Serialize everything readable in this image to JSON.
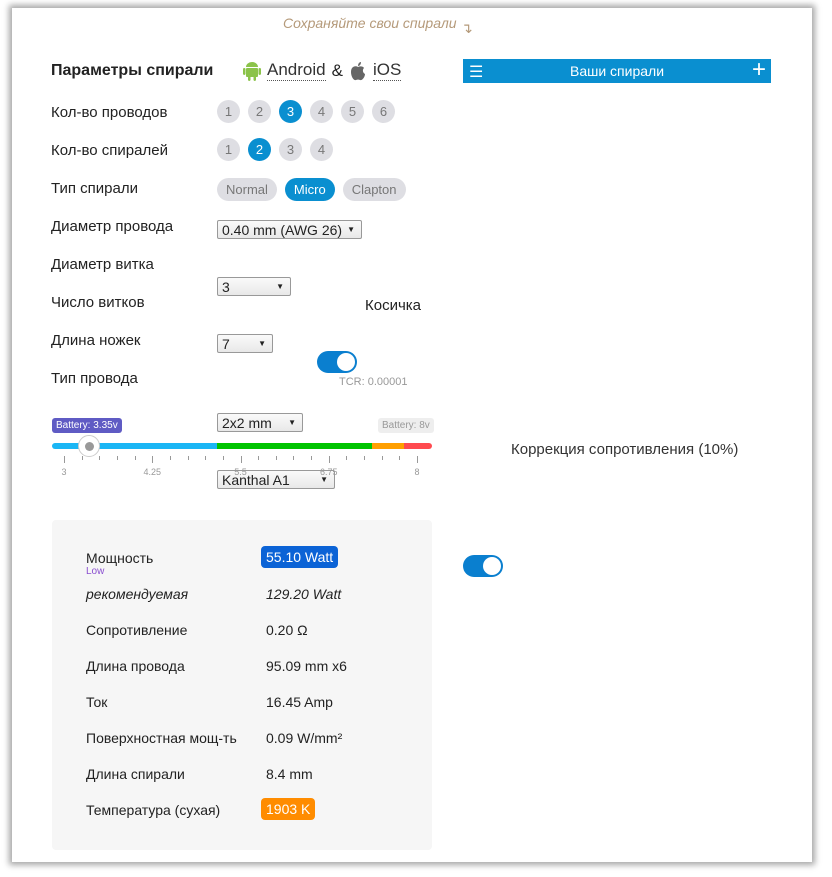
{
  "hint": "Сохраняйте свои спирали",
  "header": {
    "title": "Параметры спирали",
    "android": "Android",
    "amp": "&",
    "ios": "iOS"
  },
  "coils_bar": {
    "title": "Ваши спирали"
  },
  "wires": {
    "label": "Кол-во проводов",
    "options": [
      "1",
      "2",
      "3",
      "4",
      "5",
      "6"
    ],
    "selected": "3"
  },
  "coils": {
    "label": "Кол-во спиралей",
    "options": [
      "1",
      "2",
      "3",
      "4"
    ],
    "selected": "2"
  },
  "type": {
    "label": "Тип спирали",
    "options": [
      "Normal",
      "Micro",
      "Clapton"
    ],
    "selected": "Micro"
  },
  "wire_diameter": {
    "label": "Диаметр провода",
    "value": "0.40 mm (AWG 26)"
  },
  "coil_diameter": {
    "label": "Диаметр витка",
    "value": "3"
  },
  "wraps": {
    "label": "Число витков",
    "value": "7"
  },
  "braid": {
    "label": "Косичка",
    "on": true
  },
  "legs": {
    "label": "Длина ножек",
    "value": "2x2 mm"
  },
  "wire_type": {
    "label": "Тип провода",
    "value": "Kanthal A1",
    "tcr": "TCR: 0.00001"
  },
  "battery": {
    "min_label": "Battery: 3.35v",
    "max_label": "Battery: 8v",
    "value": 3.35,
    "min": 3,
    "max": 8,
    "ticks": [
      "3",
      "4.25",
      "5.5",
      "6.75",
      "8"
    ],
    "zones": [
      {
        "to": 5.17,
        "color": "#1ab6f5"
      },
      {
        "to": 7.36,
        "color": "#00c400"
      },
      {
        "to": 7.82,
        "color": "#ff9f00"
      },
      {
        "to": 8,
        "color": "#ff4a4f"
      }
    ]
  },
  "correction": {
    "label": "Коррекция сопротивления (10%)",
    "on": true
  },
  "results": {
    "power": {
      "label": "Мощность",
      "sub": "Low",
      "value": "55.10 Watt"
    },
    "recommended": {
      "label": "рекомендуемая",
      "value": "129.20 Watt"
    },
    "rows": [
      {
        "label": "Сопротивление",
        "value": "0.20 Ω"
      },
      {
        "label": "Длина провода",
        "value": "95.09 mm x6"
      },
      {
        "label": "Ток",
        "value": "16.45 Amp"
      },
      {
        "label": "Поверхностная мощ-ть",
        "value": "0.09 W/mm²"
      },
      {
        "label": "Длина спирали",
        "value": "8.4 mm"
      }
    ],
    "temp": {
      "label": "Температура (сухая)",
      "value": "1903 K"
    }
  },
  "colors": {
    "accent": "#0a8fd0",
    "power": "#0b63d6",
    "temp": "#ff8c00",
    "low": "#8a4fd0"
  }
}
